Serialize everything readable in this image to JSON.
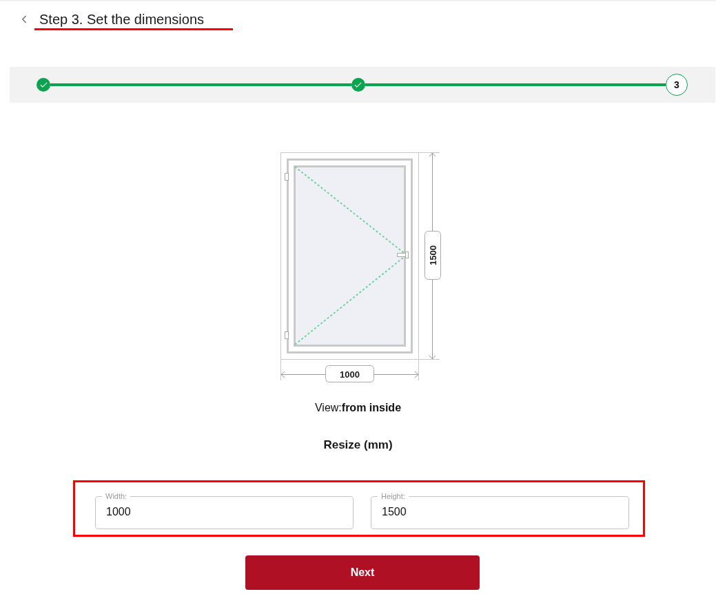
{
  "header": {
    "title": "Step 3. Set the dimensions",
    "highlighted": true
  },
  "steps": [
    {
      "kind": "done"
    },
    {
      "kind": "done"
    },
    {
      "kind": "current",
      "label": "3"
    }
  ],
  "window_drawing": {
    "width_label": "1000",
    "height_label": "1500"
  },
  "view": "View:**from inside**",
  "resize_title": "Resize (mm)",
  "dimensions_form": {
    "highlighted": true,
    "fields": [
      {
        "label": "Width:",
        "value": "1000"
      },
      {
        "label": "Height:",
        "value": "1500"
      }
    ]
  },
  "next_button": "Next"
}
